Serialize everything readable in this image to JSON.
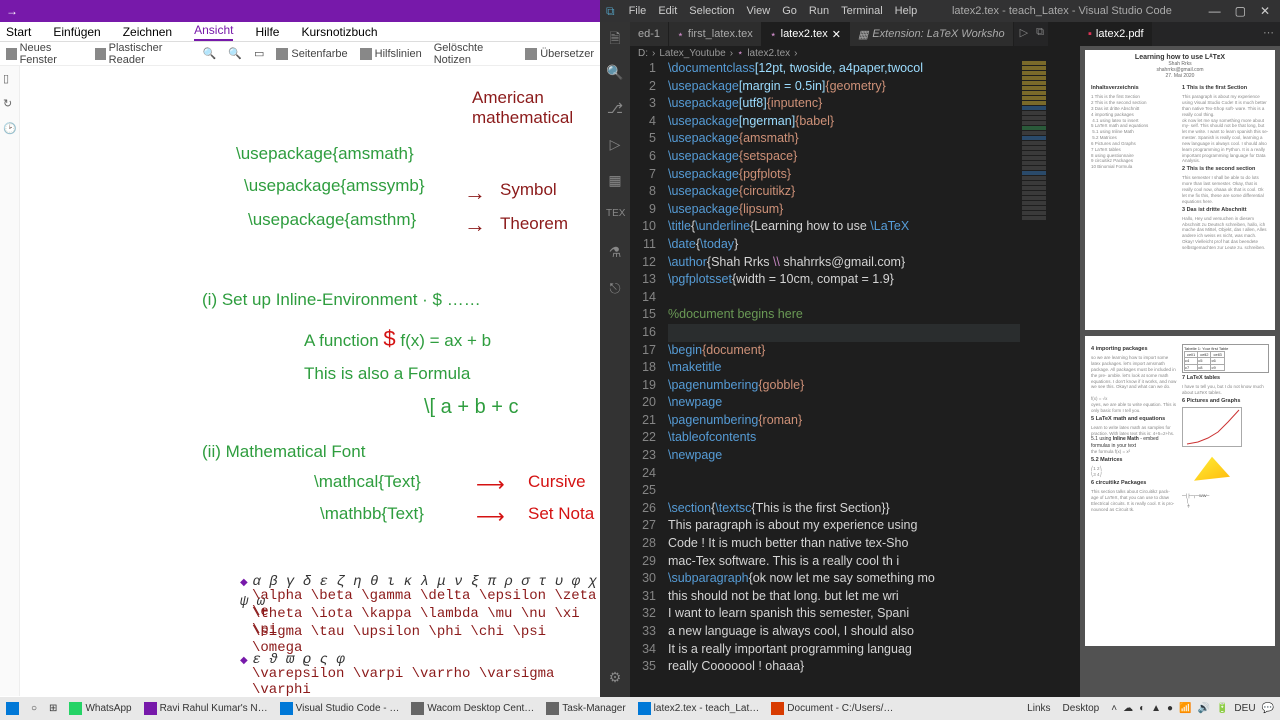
{
  "onenote": {
    "tabs": [
      "Start",
      "Einfügen",
      "Zeichnen",
      "Ansicht",
      "Hilfe",
      "Kursnotizbuch"
    ],
    "active_tab": "Ansicht",
    "toolbar": {
      "neues_fenster": "Neues Fenster",
      "plastischer": "Plastischer Reader",
      "seitenfarbe": "Seitenfarbe",
      "hilfslinien": "Hilfslinien",
      "geloeschte": "Gelöschte Notizen",
      "uebersetzer": "Übersetzer"
    },
    "handwriting": {
      "heading_note": "American mathematical",
      "pkg1": "\\usepackage{amsmath}",
      "pkg2": "\\usepackage{amssymb}",
      "pkg2_note": "Symbol",
      "pkg3": "\\usepackage{amsthm}",
      "pkg3_note": "Theorem",
      "sec_i": "(i)  Set up   Inline-Environment · $ ……",
      "line_fx": "A   function    $ f(x)  =  ax  +  b",
      "line_also": "This  is  also   a   Formula",
      "line_brackets": "\\[  a  +  b  +  c",
      "sec_ii": "(ii)   Mathematical  Font",
      "mathcal": "\\mathcal{Text}",
      "mathcal_note": "Cursive",
      "mathbb": "\\mathbb{Text}",
      "mathbb_note": "Set Nota",
      "greek_low": "α β γ δ ε ζ η θ ι κ λ μ ν ξ π ρ σ τ υ φ χ ψ ω",
      "greek_cmds1": "\\alpha \\beta \\gamma \\delta \\epsilon \\zeta \\e",
      "greek_cmds2": "\\theta \\iota \\kappa \\lambda \\mu \\nu \\xi \\pi",
      "greek_cmds3": "\\sigma \\tau \\upsilon \\phi \\chi \\psi \\omega",
      "greek_var": "ε ϑ ϖ ϱ ς φ",
      "greek_varcmds": "\\varepsilon \\varpi \\varrho \\varsigma \\varphi"
    }
  },
  "vscode": {
    "menus": [
      "File",
      "Edit",
      "Selection",
      "View",
      "Go",
      "Run",
      "Terminal",
      "Help"
    ],
    "window_title": "latex2.tex - teach_Latex - Visual Studio Code",
    "tabs": [
      {
        "label": "ed-1",
        "active": false
      },
      {
        "label": "first_latex.tex",
        "active": false
      },
      {
        "label": "latex2.tex",
        "active": true,
        "dirty": true
      },
      {
        "label": "Extension: LaTeX Worksho",
        "active": false,
        "ext": true
      }
    ],
    "pdf_tab": "latex2.pdf",
    "breadcrumb": [
      "D:",
      "Latex_Youtube",
      "latex2.tex",
      ""
    ],
    "code_lines": [
      {
        "n": 1,
        "t": "\\documentclass",
        "a": "[12pt, twoside, a4paper,twocol"
      },
      {
        "n": 2,
        "t": "\\usepackage",
        "a": "[margin = 0.5in]",
        "b": "{geometry}"
      },
      {
        "n": 3,
        "t": "\\usepackage",
        "a": "[utf8]",
        "b": "{inputenc}"
      },
      {
        "n": 4,
        "t": "\\usepackage",
        "a": "[ngerman]",
        "b": "{babel}"
      },
      {
        "n": 5,
        "t": "\\usepackage",
        "b": "{amsmath}"
      },
      {
        "n": 6,
        "t": "\\usepackage",
        "b": "{setspace}"
      },
      {
        "n": 7,
        "t": "\\usepackage",
        "b": "{pgfplots}"
      },
      {
        "n": 8,
        "t": "\\usepackage",
        "b": "{circuitikz}"
      },
      {
        "n": 9,
        "t": "\\usepackage",
        "b": "{lipsum}"
      },
      {
        "n": 10,
        "t": "\\title",
        "raw": "{\\underline{Learning how to use \\LaTeX"
      },
      {
        "n": 11,
        "t": "\\date",
        "raw": "{\\today}"
      },
      {
        "n": 12,
        "t": "\\author",
        "raw": "{Shah Rrks \\\\ shahrrks@gmail.com}"
      },
      {
        "n": 13,
        "t": "\\pgfplotsset",
        "raw": "{width = 10cm, compat = 1.9}"
      },
      {
        "n": 14,
        "blank": true
      },
      {
        "n": 15,
        "cm": "%document begins here"
      },
      {
        "n": 16,
        "blank": true,
        "hl": true
      },
      {
        "n": 17,
        "t": "\\begin",
        "b": "{document}"
      },
      {
        "n": 18,
        "t": "\\maketitle"
      },
      {
        "n": 19,
        "t": "\\pagenumbering",
        "b": "{gobble}"
      },
      {
        "n": 20,
        "t": "\\newpage"
      },
      {
        "n": 21,
        "t": "\\pagenumbering",
        "b": "{roman}"
      },
      {
        "n": 22,
        "t": "\\tableofcontents"
      },
      {
        "n": 23,
        "t": "\\newpage"
      },
      {
        "n": 24,
        "blank": true
      },
      {
        "n": 25,
        "blank": true
      },
      {
        "n": 26,
        "t": "\\section",
        "raw": "{\\textsc{This is the first Section}}"
      },
      {
        "n": 27,
        "plain": "This paragraph is about my experience using"
      },
      {
        "n": 28,
        "plain": "Code ! It is much better than native tex-Sho"
      },
      {
        "n": 29,
        "plain": "mac-Tex software. This is a really cool th i"
      },
      {
        "n": 30,
        "t": "\\subparagraph",
        "raw": "{ok now let me say something mo"
      },
      {
        "n": 31,
        "plain": "this should not be that long. but let me wri"
      },
      {
        "n": 32,
        "plain": "I want to learn spanish this semester, Spani"
      },
      {
        "n": 33,
        "plain": "a new language is always cool, I should also"
      },
      {
        "n": 34,
        "plain": "It is a really important programming languag"
      },
      {
        "n": 35,
        "plain": "really Cooooool ! ohaaa}"
      }
    ],
    "pdf": {
      "title": "Learning how to use LᴬTᴇX",
      "author": "Shah Rrks",
      "email": "shahrrks@gmail.com",
      "date": "27. Mai 2020",
      "toc": "Inhaltsverzeichnis",
      "s1": "1   This is the first Section",
      "s2": "2   This is the second section",
      "s3": "3   Das ist dritte Abschnitt",
      "s4": "4   importing packages",
      "s5": "5   LaTeX math and equations",
      "s6": "6   Pictures and Graphs",
      "smat": "5.2   Matrices",
      "scir": "6   circuitikz Packages",
      "tables": "7   LaTeX tables"
    }
  },
  "taskbar": {
    "items": [
      {
        "label": "WhatsApp",
        "color": "#25d366"
      },
      {
        "label": "Ravi Rahul Kumar's N…",
        "color": "#7719aa"
      },
      {
        "label": "Visual Studio Code - …",
        "color": "#0078d7"
      },
      {
        "label": "Wacom Desktop Cent…",
        "color": "#666"
      },
      {
        "label": "Task-Manager",
        "color": "#666"
      },
      {
        "label": "latex2.tex - teach_Lat…",
        "color": "#0078d7"
      },
      {
        "label": "Document - C:/Users/…",
        "color": "#d83b01"
      }
    ],
    "tray": {
      "links": "Links",
      "desktop": "Desktop",
      "lang": "DEU"
    }
  }
}
